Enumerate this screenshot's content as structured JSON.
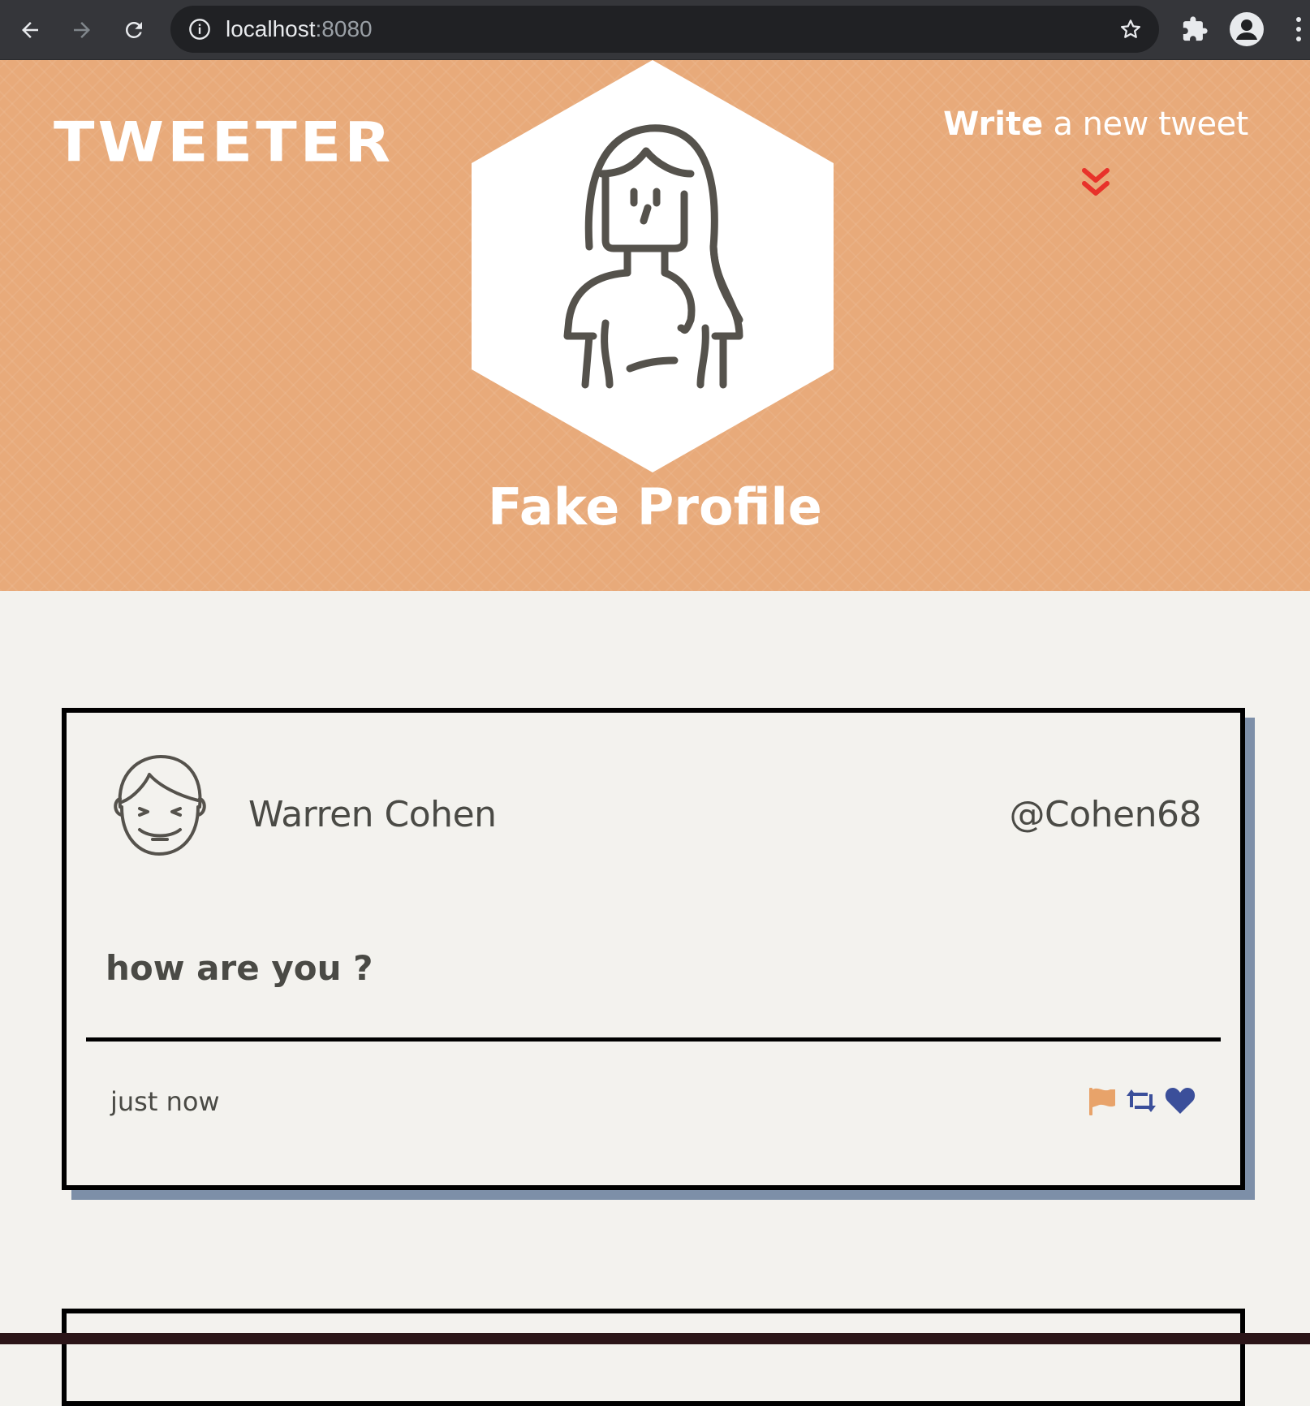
{
  "browser": {
    "url_host": "localhost",
    "url_port": ":8080"
  },
  "header": {
    "logo": "TWEETER",
    "write_bold": "Write",
    "write_rest": " a new tweet",
    "profile_name": "Fake Profile"
  },
  "tweets": [
    {
      "name": "Warren Cohen",
      "handle": "@Cohen68",
      "content": "how are you ?",
      "time": "just now"
    }
  ],
  "colors": {
    "header_bg": "#e8aa7a",
    "page_bg": "#f3f2ee",
    "chevron": "#e8322a",
    "flag": "#e8a36a",
    "retweet": "#3b4f9a",
    "heart": "#3b4f9a",
    "card_shadow": "#7d8fa8"
  },
  "icons": {
    "nav": [
      "back-arrow-icon",
      "forward-arrow-icon",
      "reload-icon"
    ],
    "omnibox": [
      "info-icon",
      "star-icon"
    ],
    "toolbar": [
      "puzzle-icon",
      "profile-icon",
      "more-vert-icon"
    ],
    "actions": [
      "flag-icon",
      "retweet-icon",
      "heart-icon"
    ]
  }
}
